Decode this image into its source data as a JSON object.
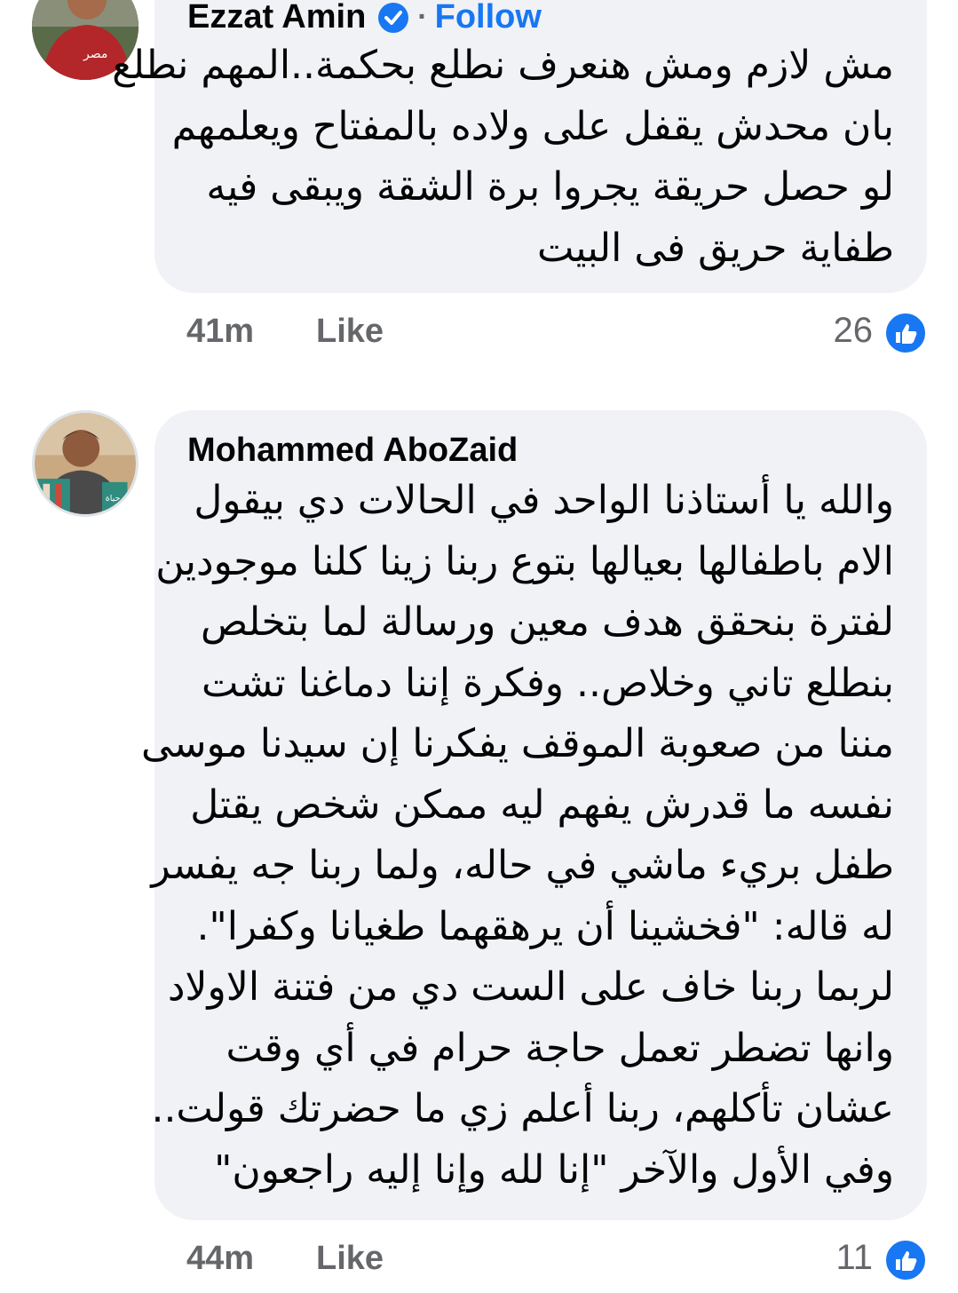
{
  "comments": [
    {
      "author": "Ezzat Amin",
      "verified_icon": "verified-badge-icon",
      "separator": "·",
      "follow_label": "Follow",
      "avatar_icon": "user-avatar",
      "lines": [
        "مش لازم ومش هنعرف نطلع بحكمة..المهم نطلع",
        "بان محدش يقفل على ولاده بالمفتاح ويعلمهم",
        "لو حصل حريقة يجروا برة الشقة ويبقى فيه",
        "طفاية حريق فى البيت"
      ],
      "time": "41m",
      "like_label": "Like",
      "reaction_count": "26",
      "reaction_icon": "like-reaction-icon"
    },
    {
      "author": "Mohammed AboZaid",
      "avatar_icon": "user-avatar",
      "lines": [
        "والله يا أستاذنا الواحد في الحالات دي بيقول",
        "الام باطفالها بعيالها بتوع ربنا زينا كلنا موجودين",
        "لفترة بنحقق هدف معين ورسالة لما بتخلص",
        "بنطلع تاني وخلاص.. وفكرة إننا دماغنا تشت",
        "مننا من صعوبة الموقف يفكرنا إن سيدنا موسى",
        "نفسه ما قدرش يفهم ليه ممكن شخص يقتل",
        "طفل بريء ماشي في حاله، ولما ربنا جه يفسر",
        "له قاله: \"فخشينا أن يرهقهما طغيانا وكفرا\".",
        "لربما ربنا خاف على الست دي من فتنة الاولاد",
        "وانها تضطر تعمل حاجة حرام في أي وقت",
        "عشان تأكلهم، ربنا أعلم زي ما حضرتك قولت..",
        "وفي الأول والآخر \"إنا لله وإنا إليه راجعون\""
      ],
      "time": "44m",
      "like_label": "Like",
      "reaction_count": "11",
      "reaction_icon": "like-reaction-icon"
    }
  ],
  "colors": {
    "bubble_bg": "#f0f2f5",
    "accent": "#1877f2",
    "meta_text": "#65676b",
    "text": "#050505"
  }
}
